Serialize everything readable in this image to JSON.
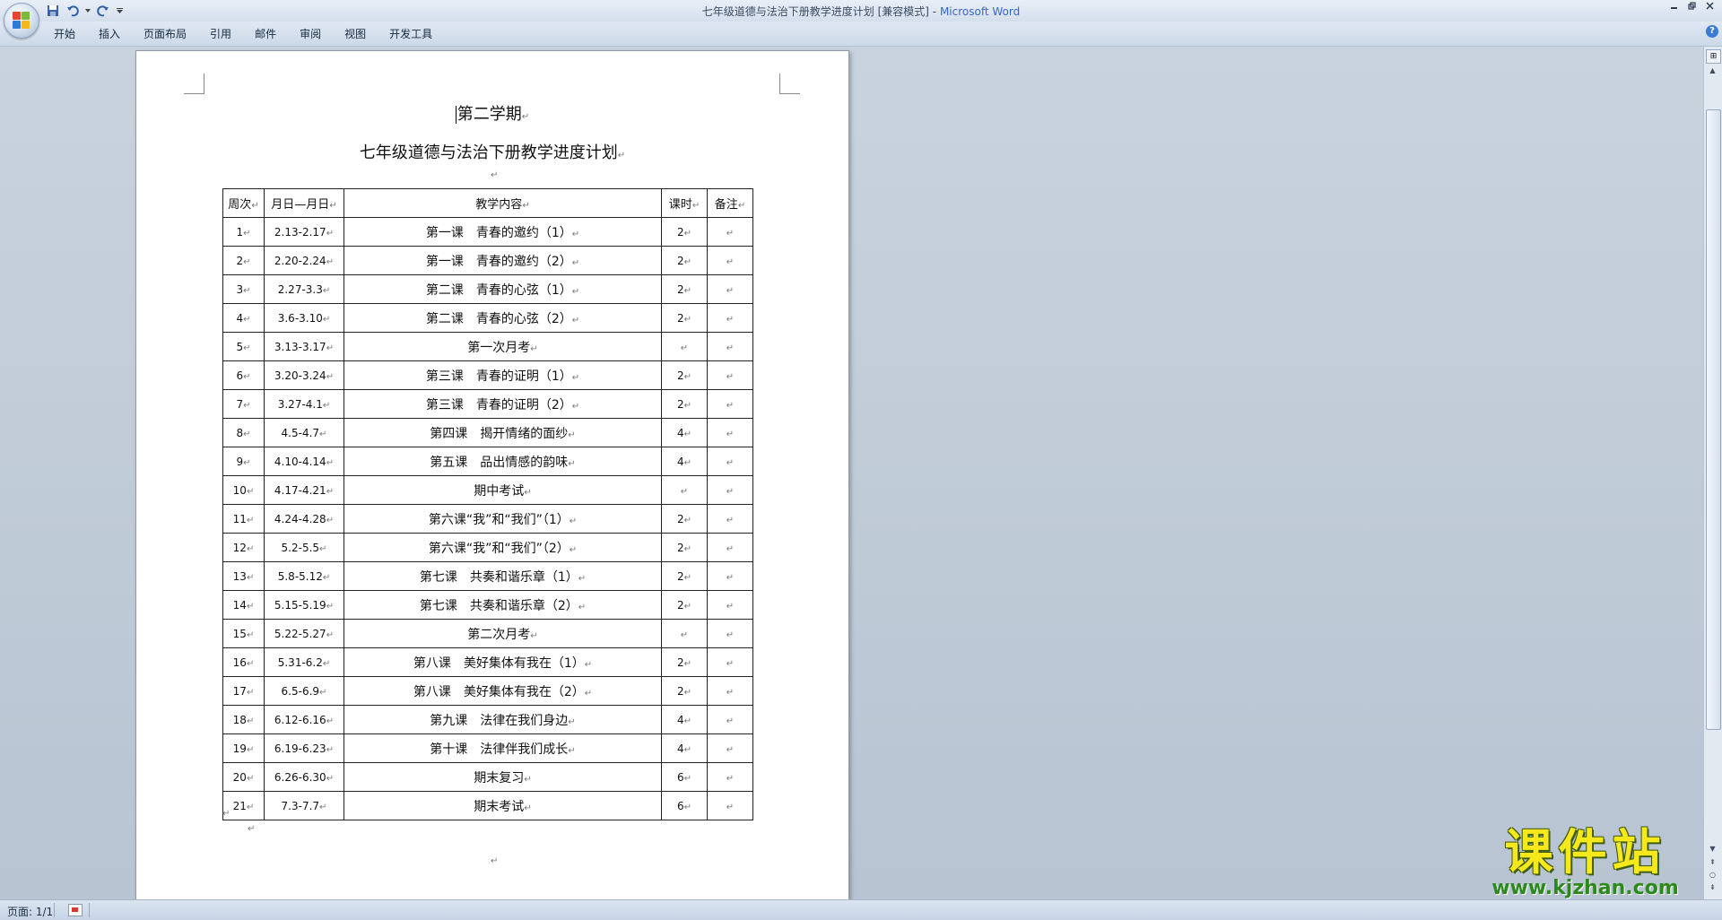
{
  "window": {
    "title_doc": "七年级道德与法治下册教学进度计划 [兼容模式]",
    "title_sep": " - ",
    "title_app": "Microsoft Word"
  },
  "ribbon": {
    "tabs": [
      "开始",
      "插入",
      "页面布局",
      "引用",
      "邮件",
      "审阅",
      "视图",
      "开发工具"
    ]
  },
  "document": {
    "heading1": "第二学期",
    "heading2": "七年级道德与法治下册教学进度计划",
    "para_mark": "↵",
    "table": {
      "headers": [
        "周次",
        "月日—月日",
        "教学内容",
        "课时",
        "备注"
      ],
      "rows": [
        {
          "week": "1",
          "dates": "2.13-2.17",
          "content": "第一课　青春的邀约（1）",
          "hours": "2",
          "notes": ""
        },
        {
          "week": "2",
          "dates": "2.20-2.24",
          "content": "第一课　青春的邀约（2）",
          "hours": "2",
          "notes": ""
        },
        {
          "week": "3",
          "dates": "2.27-3.3",
          "content": "第二课　青春的心弦（1）",
          "hours": "2",
          "notes": ""
        },
        {
          "week": "4",
          "dates": "3.6-3.10",
          "content": "第二课　青春的心弦（2）",
          "hours": "2",
          "notes": ""
        },
        {
          "week": "5",
          "dates": "3.13-3.17",
          "content": "第一次月考",
          "hours": "",
          "notes": ""
        },
        {
          "week": "6",
          "dates": "3.20-3.24",
          "content": "第三课　青春的证明（1）",
          "hours": "2",
          "notes": ""
        },
        {
          "week": "7",
          "dates": "3.27-4.1",
          "content": "第三课　青春的证明（2）",
          "hours": "2",
          "notes": ""
        },
        {
          "week": "8",
          "dates": "4.5-4.7",
          "content": "第四课　揭开情绪的面纱",
          "hours": "4",
          "notes": ""
        },
        {
          "week": "9",
          "dates": "4.10-4.14",
          "content": "第五课　品出情感的韵味",
          "hours": "4",
          "notes": ""
        },
        {
          "week": "10",
          "dates": "4.17-4.21",
          "content": "期中考试",
          "hours": "",
          "notes": ""
        },
        {
          "week": "11",
          "dates": "4.24-4.28",
          "content": "第六课“我”和“我们”（1）",
          "hours": "2",
          "notes": ""
        },
        {
          "week": "12",
          "dates": "5.2-5.5",
          "content": "第六课“我”和“我们”（2）",
          "hours": "2",
          "notes": ""
        },
        {
          "week": "13",
          "dates": "5.8-5.12",
          "content": "第七课　共奏和谐乐章（1）",
          "hours": "2",
          "notes": ""
        },
        {
          "week": "14",
          "dates": "5.15-5.19",
          "content": "第七课　共奏和谐乐章（2）",
          "hours": "2",
          "notes": ""
        },
        {
          "week": "15",
          "dates": "5.22-5.27",
          "content": "第二次月考",
          "hours": "",
          "notes": ""
        },
        {
          "week": "16",
          "dates": "5.31-6.2",
          "content": "第八课　美好集体有我在（1）",
          "hours": "2",
          "notes": ""
        },
        {
          "week": "17",
          "dates": "6.5-6.9",
          "content": "第八课　美好集体有我在（2）",
          "hours": "2",
          "notes": ""
        },
        {
          "week": "18",
          "dates": "6.12-6.16",
          "content": "第九课　法律在我们身边",
          "hours": "4",
          "notes": ""
        },
        {
          "week": "19",
          "dates": "6.19-6.23",
          "content": "第十课　法律伴我们成长",
          "hours": "4",
          "notes": ""
        },
        {
          "week": "20",
          "dates": "6.26-6.30",
          "content": "期末复习",
          "hours": "6",
          "notes": ""
        },
        {
          "week": "21",
          "dates": "7.3-7.7",
          "content": "期末考试",
          "hours": "6",
          "notes": ""
        }
      ]
    }
  },
  "statusbar": {
    "page_info": "页面: 1/1"
  },
  "watermark": {
    "title": "课件站",
    "url": "www.kjzhan.com"
  },
  "colors": {
    "app_title": "#3767c6",
    "watermark_yellow": "#f6e81a",
    "watermark_green": "#2c8a1c"
  }
}
